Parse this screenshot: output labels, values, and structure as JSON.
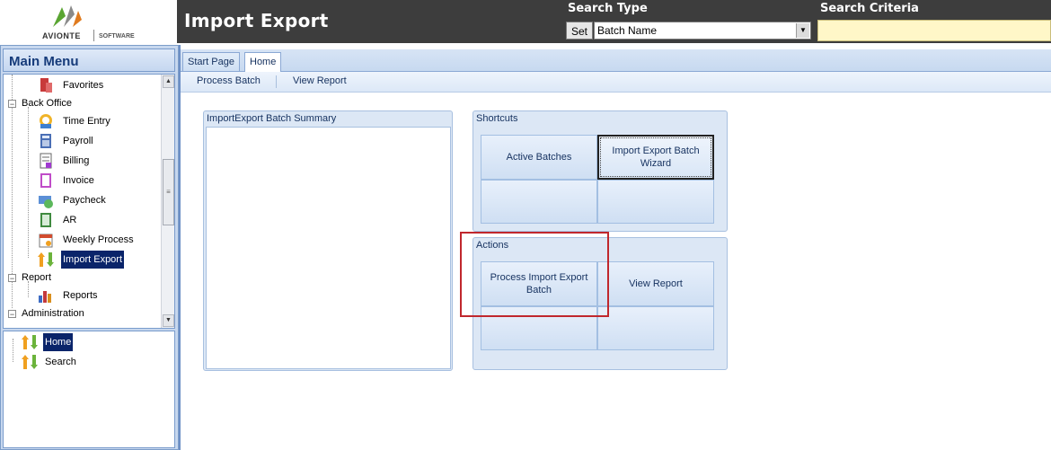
{
  "header": {
    "logo_brand": "AVIONTE",
    "logo_sub": "SOFTWARE",
    "app_title": "Import Export",
    "search_type_label": "Search Type",
    "search_criteria_label": "Search Criteria",
    "set_button": "Set",
    "search_type_value": "Batch Name",
    "search_criteria_value": ""
  },
  "sidebar": {
    "title": "Main Menu",
    "tree": {
      "favorites": "Favorites",
      "back_office": "Back Office",
      "time_entry": "Time Entry",
      "payroll": "Payroll",
      "billing": "Billing",
      "invoice": "Invoice",
      "paycheck": "Paycheck",
      "ar": "AR",
      "weekly_process": "Weekly Process",
      "import_export": "Import Export",
      "report": "Report",
      "reports": "Reports",
      "administration": "Administration"
    },
    "nav": {
      "home": "Home",
      "search": "Search"
    }
  },
  "tabs": {
    "start_page": "Start Page",
    "home": "Home"
  },
  "toolbar": {
    "process_batch": "Process Batch",
    "view_report": "View Report"
  },
  "panels": {
    "batch_summary_title": "ImportExport Batch Summary",
    "shortcuts_title": "Shortcuts",
    "active_batches": "Active Batches",
    "import_export_wizard": "Import Export Batch Wizard",
    "actions_title": "Actions",
    "process_import_export_batch": "Process Import Export Batch",
    "view_report": "View Report"
  },
  "colors": {
    "topbar": "#3d3d3d",
    "selection": "#0a246a",
    "highlight": "#c0272d",
    "panel_bg": "#dce7f5"
  }
}
